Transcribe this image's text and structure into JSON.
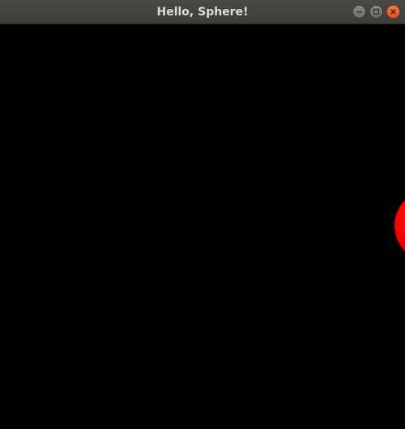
{
  "window": {
    "title": "Hello, Sphere!"
  },
  "controls": {
    "minimize_icon": "minimize-icon",
    "maximize_icon": "maximize-icon",
    "close_icon": "close-icon"
  },
  "scene": {
    "background_color": "#000000",
    "sphere_color": "#ff0000",
    "sphere_shadow_color": "#5a0000"
  }
}
